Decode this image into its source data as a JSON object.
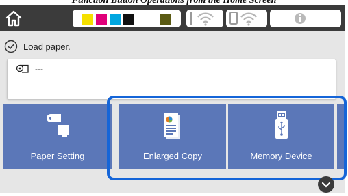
{
  "caption": "Function Button Operations from the Home Screen",
  "header": {
    "home_icon": "home-icon",
    "inks": [
      {
        "color": "#f5e000",
        "level": 0.85
      },
      {
        "color": "#e0007a",
        "level": 0.85
      },
      {
        "color": "#00a6e0",
        "level": 0.85
      },
      {
        "color": "#111111",
        "level": 0.85
      },
      {
        "color": "#5a5a14",
        "level": 0.85
      }
    ],
    "wireless_icon": "wifi-icon",
    "wifi_direct_icon": "wifi-direct-icon",
    "info_icon": "info-icon"
  },
  "status": {
    "icon": "check-circle-icon",
    "message": "Load paper."
  },
  "paper_panel": {
    "icon": "roll-paper-icon",
    "value": "---"
  },
  "tiles": [
    {
      "label": "Paper Setting",
      "icon": "paper-setting-icon"
    },
    {
      "label": "Enlarged Copy",
      "icon": "enlarged-copy-icon"
    },
    {
      "label": "Memory Device",
      "icon": "usb-icon"
    }
  ],
  "colors": {
    "tile": "#5b77b8",
    "highlight": "#1565d8",
    "header": "#3b3b3b"
  }
}
